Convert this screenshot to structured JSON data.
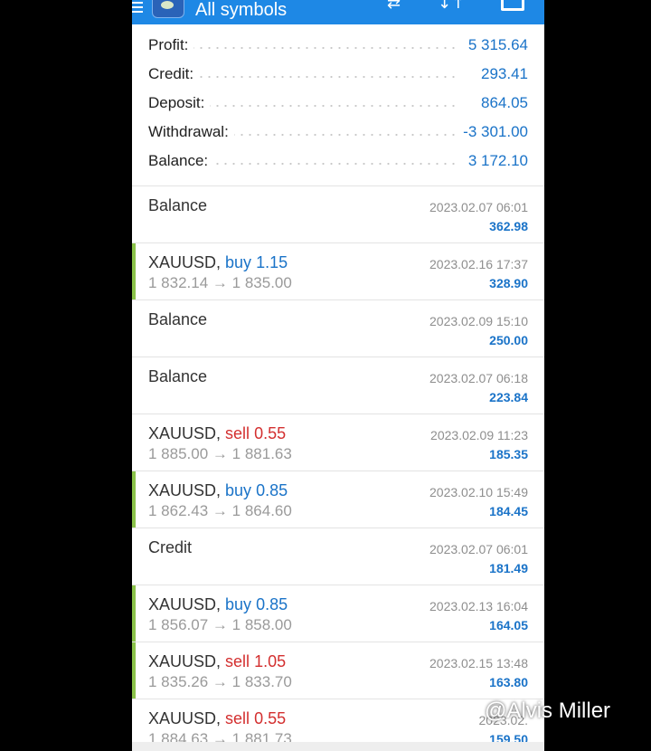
{
  "header": {
    "title": "All symbols",
    "icons": [
      "menu-icon",
      "app-logo",
      "currency-icon",
      "sort-icon",
      "save-icon"
    ]
  },
  "summary": [
    {
      "label": "Profit:",
      "value": "5 315.64"
    },
    {
      "label": "Credit:",
      "value": "293.41"
    },
    {
      "label": "Deposit:",
      "value": "864.05"
    },
    {
      "label": "Withdrawal:",
      "value": "-3 301.00"
    },
    {
      "label": "Balance:",
      "value": "3 172.10"
    }
  ],
  "deals": [
    {
      "symbol": "Balance",
      "side": "",
      "volume": "",
      "open": "",
      "close": "",
      "time": "2023.02.07 06:01",
      "profit": "362.98"
    },
    {
      "symbol": "XAUUSD,",
      "side": "buy",
      "volume": "1.15",
      "open": "1 832.14",
      "close": "1 835.00",
      "time": "2023.02.16 17:37",
      "profit": "328.90"
    },
    {
      "symbol": "Balance",
      "side": "",
      "volume": "",
      "open": "",
      "close": "",
      "time": "2023.02.09 15:10",
      "profit": "250.00"
    },
    {
      "symbol": "Balance",
      "side": "",
      "volume": "",
      "open": "",
      "close": "",
      "time": "2023.02.07 06:18",
      "profit": "223.84"
    },
    {
      "symbol": "XAUUSD,",
      "side": "sell",
      "volume": "0.55",
      "open": "1 885.00",
      "close": "1 881.63",
      "time": "2023.02.09 11:23",
      "profit": "185.35"
    },
    {
      "symbol": "XAUUSD,",
      "side": "buy",
      "volume": "0.85",
      "open": "1 862.43",
      "close": "1 864.60",
      "time": "2023.02.10 15:49",
      "profit": "184.45"
    },
    {
      "symbol": "Credit",
      "side": "",
      "volume": "",
      "open": "",
      "close": "",
      "time": "2023.02.07 06:01",
      "profit": "181.49"
    },
    {
      "symbol": "XAUUSD,",
      "side": "buy",
      "volume": "0.85",
      "open": "1 856.07",
      "close": "1 858.00",
      "time": "2023.02.13 16:04",
      "profit": "164.05"
    },
    {
      "symbol": "XAUUSD,",
      "side": "sell",
      "volume": "1.05",
      "open": "1 835.26",
      "close": "1 833.70",
      "time": "2023.02.15 13:48",
      "profit": "163.80"
    },
    {
      "symbol": "XAUUSD,",
      "side": "sell",
      "volume": "0.55",
      "open": "1 884.63",
      "close": "1 881.73",
      "time": "2023.02.",
      "profit": "159.50"
    }
  ],
  "arrow": "→",
  "watermark": "@Alvis Miller",
  "colors": {
    "header": "#1e88e5",
    "buy": "#1a73c8",
    "sell": "#d32f2f",
    "profit": "#1a73c8",
    "marker": "#8bc34a"
  }
}
